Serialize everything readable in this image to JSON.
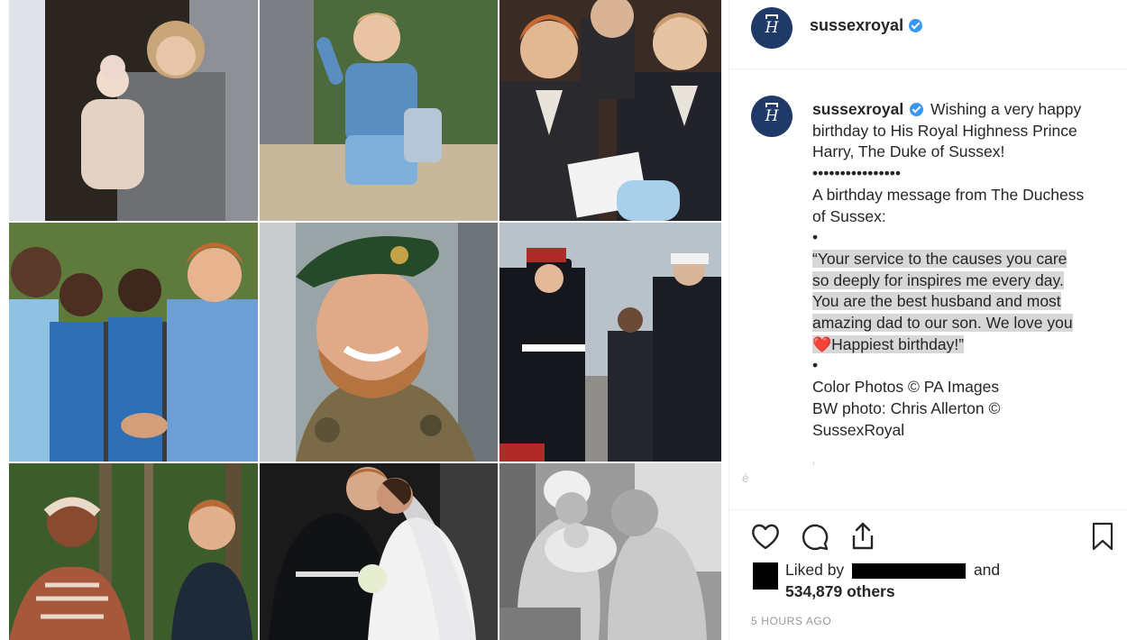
{
  "post": {
    "username": "sussexroyal",
    "avatar_monogram": "H",
    "caption": {
      "lines": [
        "Wishing a very happy",
        "birthday to His Royal Highness Prince",
        "Harry, The Duke of Sussex!",
        "••••••••••••••••",
        "A birthday message from The Duchess",
        "of Sussex:",
        "•",
        "“Your service to the causes you care",
        "so deeply for inspires me every day.",
        "You are the best husband and most",
        "amazing dad to our son. We love you",
        "Happiest birthday!”",
        "•",
        "Color Photos © PA Images",
        "BW photo: Chris Allerton ©",
        "SussexRoyal"
      ]
    },
    "faint_marks": [
      "é",
      "ʼ"
    ],
    "likes": {
      "prefix": "Liked by",
      "suffix": "and",
      "count_text": "534,879 others"
    },
    "timestamp": "5 HOURS AGO"
  },
  "photos": [
    {
      "name": "photo-mother-with-baby",
      "palette": [
        "#3a2a22",
        "#d9c4b4",
        "#6d6f73"
      ]
    },
    {
      "name": "photo-boy-waving",
      "palette": [
        "#4d6a3c",
        "#5b8ec0",
        "#c7b89c"
      ]
    },
    {
      "name": "photo-young-princes-suits",
      "palette": [
        "#2a2a2e",
        "#e8e4dc",
        "#c79a6e"
      ]
    },
    {
      "name": "photo-schoolchildren-handshake",
      "palette": [
        "#4a6b2f",
        "#2e6fb6",
        "#7fb0dc"
      ]
    },
    {
      "name": "photo-green-beret-portrait",
      "palette": [
        "#9aa3a6",
        "#244a2a",
        "#7a6a48"
      ]
    },
    {
      "name": "photo-ceremony-salute",
      "palette": [
        "#b9c2ca",
        "#15171c",
        "#b12a2a"
      ]
    },
    {
      "name": "photo-rainforest-meeting",
      "palette": [
        "#3d5c2c",
        "#c47b4e",
        "#1f2a38"
      ]
    },
    {
      "name": "photo-wedding-kiss",
      "palette": [
        "#1a1a1a",
        "#f2f2f2",
        "#3b3b3b"
      ]
    },
    {
      "name": "photo-bw-family-baby",
      "palette": [
        "#6b6b6b",
        "#d6d6d6",
        "#9a9a9a"
      ]
    }
  ],
  "colors": {
    "avatar_bg": "#1f3a66",
    "verified": "#3897f0",
    "heart": "#ed4956",
    "highlight": "#d7d7d7"
  },
  "icons": [
    "heart-icon",
    "comment-icon",
    "share-icon",
    "bookmark-icon",
    "verified-badge-icon"
  ]
}
